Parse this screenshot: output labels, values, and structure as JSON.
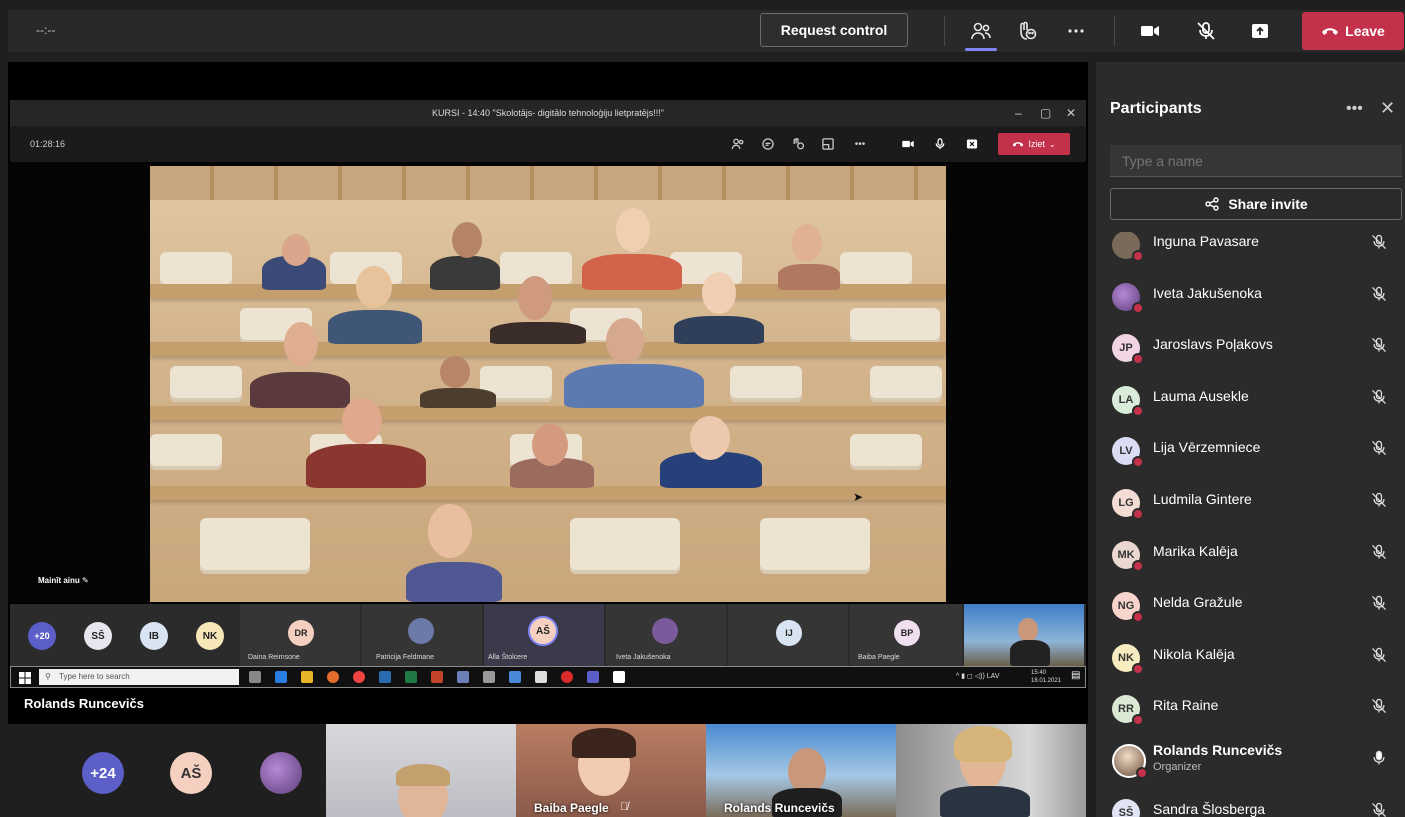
{
  "topbar": {
    "timer": "--:--",
    "request_control": "Request control",
    "leave": "Leave"
  },
  "share": {
    "window_title": "KURSI - 14:40 \"Skolotājs- digitālo tehnoloģiju lietpratējs!!!\"",
    "timer": "01:28:16",
    "iziet": "Iziet",
    "mainit_ainu": "Mainīt ainu",
    "strip": {
      "overflow": "+20",
      "initials": [
        "SŠ",
        "IB",
        "NK"
      ],
      "tiles": [
        {
          "initials": "DR",
          "name": "Daina Reimsone"
        },
        {
          "initials": "",
          "name": "Patricija Feldmane"
        },
        {
          "initials": "AŠ",
          "name": "Alla Štolcere"
        },
        {
          "initials": "",
          "name": "Iveta Jakušenoka"
        },
        {
          "initials": "IJ",
          "name": ""
        },
        {
          "initials": "BP",
          "name": "Baiba Paegle"
        }
      ]
    },
    "taskbar": {
      "search_placeholder": "Type here to search",
      "time": "15:40",
      "date": "18.01.2021",
      "lang": "LAV"
    }
  },
  "speaker_name": "Rolands Runcevičs",
  "bottom": {
    "overflow": "+24",
    "initials": "AŠ",
    "tiles": [
      {
        "name": ""
      },
      {
        "name": "Baiba Paegle"
      },
      {
        "name": "Rolands Runcevičs"
      },
      {
        "name": ""
      }
    ]
  },
  "panel": {
    "title": "Participants",
    "search_placeholder": "Type a name",
    "share_invite": "Share invite",
    "participants": [
      {
        "initials": "",
        "name": "Inguna Pavasare",
        "role": "",
        "mic": "muted"
      },
      {
        "initials": "",
        "name": "Iveta Jakušenoka",
        "role": "",
        "mic": "muted"
      },
      {
        "initials": "JP",
        "name": "Jaroslavs Poļakovs",
        "role": "",
        "mic": "muted"
      },
      {
        "initials": "LA",
        "name": "Lauma Ausekle",
        "role": "",
        "mic": "muted"
      },
      {
        "initials": "LV",
        "name": "Lija Vērzemniece",
        "role": "",
        "mic": "muted"
      },
      {
        "initials": "LG",
        "name": "Ludmila Gintere",
        "role": "",
        "mic": "muted"
      },
      {
        "initials": "MK",
        "name": "Marika Kalēja",
        "role": "",
        "mic": "muted"
      },
      {
        "initials": "NG",
        "name": "Nelda Gražule",
        "role": "",
        "mic": "muted"
      },
      {
        "initials": "NK",
        "name": "Nikola Kalēja",
        "role": "",
        "mic": "muted"
      },
      {
        "initials": "RR",
        "name": "Rita Raine",
        "role": "",
        "mic": "muted"
      },
      {
        "initials": "",
        "name": "Rolands Runcevičs",
        "role": "Organizer",
        "mic": "on"
      },
      {
        "initials": "SŠ",
        "name": "Sandra Šlosberga",
        "role": "",
        "mic": "muted"
      }
    ]
  },
  "colors": {
    "leave_red": "#c4314b",
    "accent": "#7f85f5",
    "panel_bg": "#2b2b2b"
  }
}
